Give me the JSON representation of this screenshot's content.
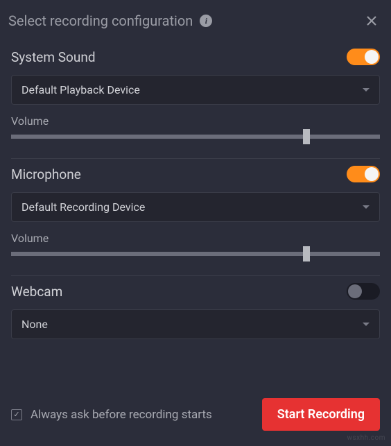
{
  "header": {
    "title": "Select recording configuration"
  },
  "sections": {
    "system_sound": {
      "label": "System Sound",
      "toggle_on": true,
      "selected": "Default Playback Device",
      "volume_label": "Volume",
      "volume_percent": 80
    },
    "microphone": {
      "label": "Microphone",
      "toggle_on": true,
      "selected": "Default Recording Device",
      "volume_label": "Volume",
      "volume_percent": 80
    },
    "webcam": {
      "label": "Webcam",
      "toggle_on": false,
      "selected": "None"
    }
  },
  "footer": {
    "checkbox_checked": true,
    "checkbox_label": "Always ask before recording starts",
    "start_button": "Start Recording"
  },
  "colors": {
    "accent": "#ff8c1a",
    "primary_button": "#e63232"
  }
}
